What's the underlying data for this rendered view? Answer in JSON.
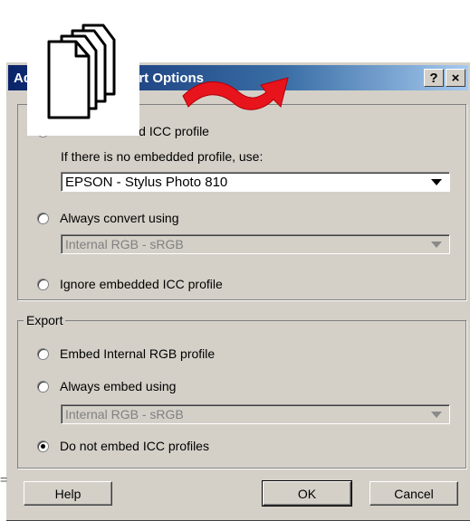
{
  "window": {
    "title": "Adobe Import/Export Options",
    "help_button": "?",
    "close_button": "×"
  },
  "import": {
    "use_embedded": "Use embedded ICC profile",
    "no_embedded_caption": "If there is no embedded profile, use:",
    "no_embedded_value": "EPSON - Stylus Photo 810",
    "always_convert": "Always convert using",
    "always_convert_value": "Internal RGB - sRGB",
    "ignore": "Ignore embedded ICC profile"
  },
  "export": {
    "legend": "Export",
    "embed_internal": "Embed Internal RGB profile",
    "always_embed": "Always embed using",
    "always_embed_value": "Internal RGB - sRGB",
    "do_not_embed": "Do not embed ICC profiles",
    "selected": "do_not_embed"
  },
  "buttons": {
    "help": "Help",
    "ok": "OK",
    "cancel": "Cancel"
  },
  "colors": {
    "dialog_bg": "#d4d0c8",
    "title_bg": "#0a246a",
    "arrow": "#e8141c"
  },
  "icons": [
    "documents-stack-icon",
    "red-curved-arrow-icon"
  ]
}
